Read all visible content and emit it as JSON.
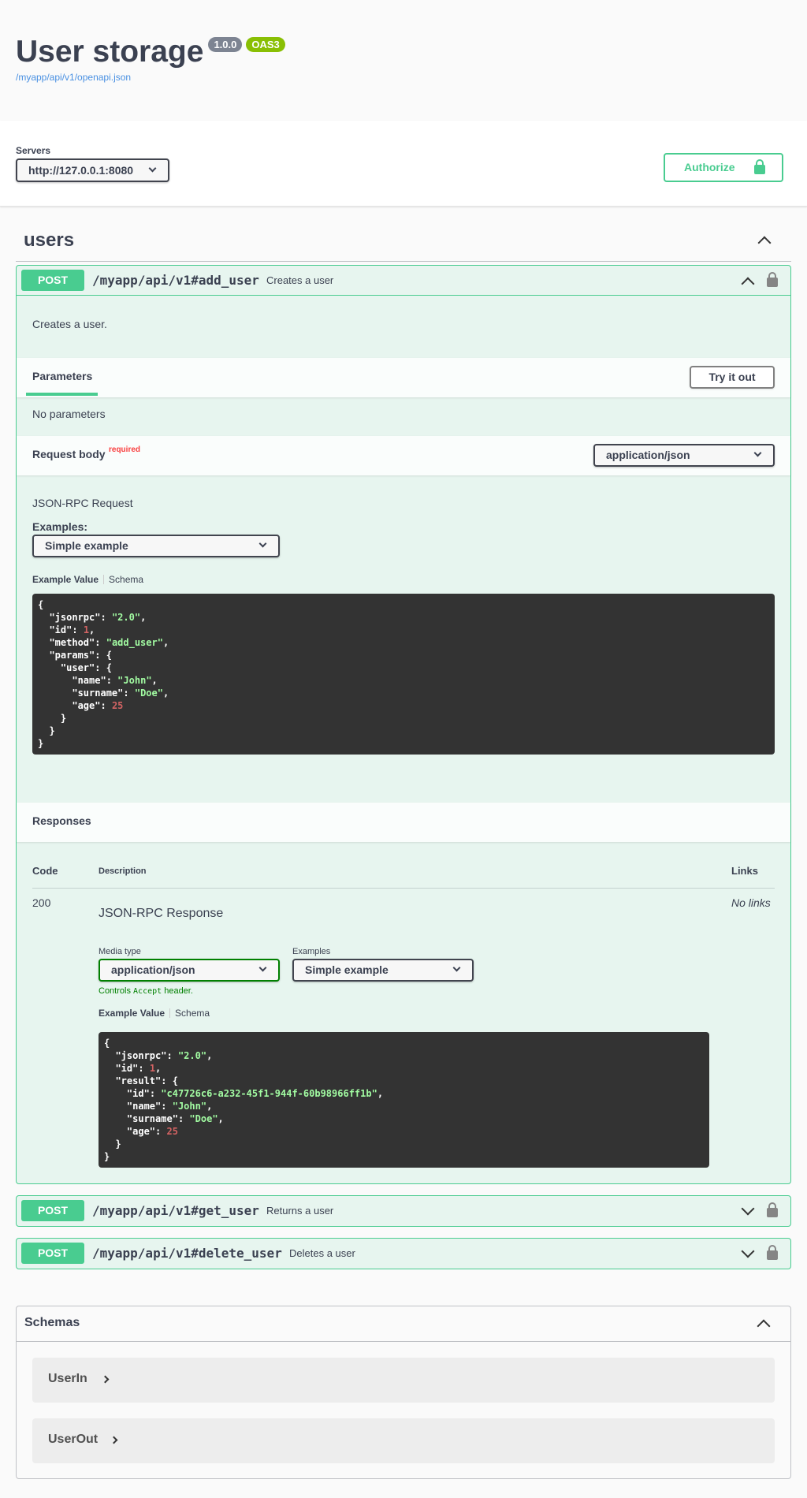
{
  "info": {
    "title": "User storage",
    "version": "1.0.0",
    "oas": "OAS3",
    "spec_url": "/myapp/api/v1/openapi.json"
  },
  "servers": {
    "label": "Servers",
    "selected": "http://127.0.0.1:8080",
    "authorize_label": "Authorize"
  },
  "tag": {
    "name": "users"
  },
  "operations": [
    {
      "method": "POST",
      "path": "/myapp/api/v1#add_user",
      "summary": "Creates a user",
      "description": "Creates a user.",
      "parameters_tab": "Parameters",
      "try_it_out": "Try it out",
      "no_parameters": "No parameters",
      "request_body_label": "Request body",
      "required_label": "required",
      "content_type": "application/json",
      "request_description": "JSON-RPC Request",
      "examples_label": "Examples:",
      "example_selected": "Simple example",
      "example_value_tab": "Example Value",
      "schema_tab": "Schema",
      "responses_label": "Responses",
      "responses_table": {
        "col_code": "Code",
        "col_description": "Description",
        "col_links": "Links",
        "rows": [
          {
            "code": "200",
            "description": "JSON-RPC Response",
            "links": "No links",
            "media_type_label": "Media type",
            "media_type": "application/json",
            "examples_label": "Examples",
            "example_selected": "Simple example",
            "controls_text_1": "Controls ",
            "controls_code": "Accept",
            "controls_text_2": " header.",
            "example_value_tab": "Example Value",
            "schema_tab": "Schema"
          }
        ]
      }
    },
    {
      "method": "POST",
      "path": "/myapp/api/v1#get_user",
      "summary": "Returns a user"
    },
    {
      "method": "POST",
      "path": "/myapp/api/v1#delete_user",
      "summary": "Deletes a user"
    }
  ],
  "request_example": {
    "jsonrpc": "2.0",
    "id": "1",
    "method": "add_user",
    "user_name": "John",
    "user_surname": "Doe",
    "user_age": "25"
  },
  "response_example": {
    "jsonrpc": "2.0",
    "id": "1",
    "result_id": "c47726c6-a232-45f1-944f-60b98966ff1b",
    "result_name": "John",
    "result_surname": "Doe",
    "result_age": "25"
  },
  "schemas": {
    "title": "Schemas",
    "models": [
      "UserIn",
      "UserOut"
    ]
  }
}
